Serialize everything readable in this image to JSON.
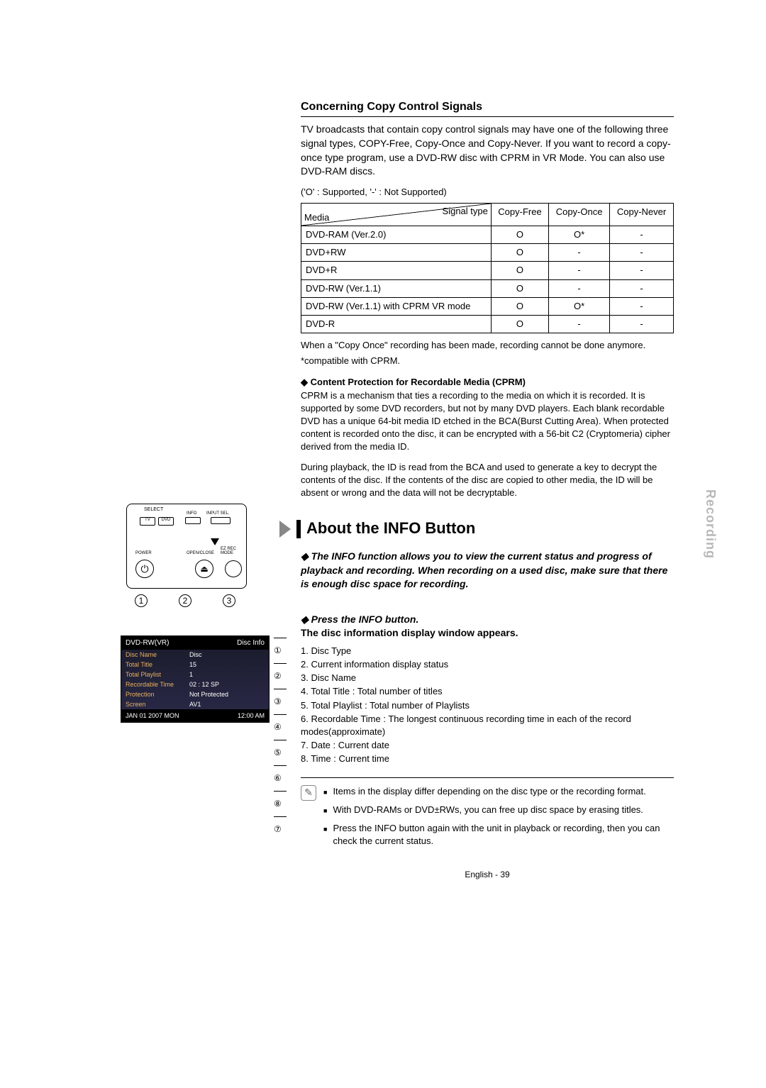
{
  "side_tab": "Recording",
  "section1": {
    "heading": "Concerning Copy Control Signals",
    "body": "TV broadcasts that contain copy control signals may have one of the following three signal types, COPY-Free, Copy-Once and Copy-Never. If you want to record a copy-once type program, use a DVD-RW disc with CPRM in VR Mode. You can also use DVD-RAM discs.",
    "legend": "('O' : Supported, '-' : Not Supported)"
  },
  "table": {
    "diag_top": "Signal type",
    "diag_bottom": "Media",
    "cols": [
      "Copy-Free",
      "Copy-Once",
      "Copy-Never"
    ],
    "rows": [
      {
        "media": "DVD-RAM (Ver.2.0)",
        "v": [
          "O",
          "O*",
          "-"
        ]
      },
      {
        "media": "DVD+RW",
        "v": [
          "O",
          "-",
          "-"
        ]
      },
      {
        "media": "DVD+R",
        "v": [
          "O",
          "-",
          "-"
        ]
      },
      {
        "media": "DVD-RW (Ver.1.1)",
        "v": [
          "O",
          "-",
          "-"
        ]
      },
      {
        "media": "DVD-RW (Ver.1.1) with CPRM VR mode",
        "v": [
          "O",
          "O*",
          "-"
        ]
      },
      {
        "media": "DVD-R",
        "v": [
          "O",
          "-",
          "-"
        ]
      }
    ],
    "footnote1": "When a \"Copy Once\" recording has been made, recording cannot be done anymore.",
    "footnote2": "*compatible with CPRM."
  },
  "cprm": {
    "head": "Content Protection for Recordable Media (CPRM)",
    "p1": "CPRM is a mechanism that ties a recording to the media on which it is recorded. It is supported by some DVD recorders, but not by many DVD players. Each blank recordable DVD has a unique 64-bit media ID etched in the BCA(Burst Cutting Area). When protected content is recorded onto the disc, it can be encrypted with a 56-bit C2 (Cryptomeria) cipher derived from the media ID.",
    "p2": "During playback, the ID is read from the BCA and used to generate a key to decrypt the contents of the disc. If the contents of the disc are copied to other media, the ID will be absent or wrong and the data will not be decryptable."
  },
  "section2": {
    "title": "About the INFO Button",
    "lead": "The INFO function allows you to view the current status and progress of playback and recording. When recording on a used disc, make sure that there is enough disc space for recording.",
    "step_head": "Press the INFO button.",
    "step_sub": "The disc information display window appears.",
    "items": [
      "1. Disc Type",
      "2. Current information display status",
      "3. Disc Name",
      "4. Total Title : Total number of titles",
      "5. Total Playlist : Total number of Playlists",
      "6. Recordable Time : The longest continuous recording time in each of the record modes(approximate)",
      "7. Date : Current date",
      "8. Time : Current time"
    ]
  },
  "notes": [
    "Items in the display differ depending on the disc type or the recording format.",
    "With DVD-RAMs or DVD±RWs, you can free up disc space by erasing titles.",
    "Press the INFO button again with the unit in playback or recording, then you can check the current status."
  ],
  "notes_info_word": "INFO",
  "page_footer": "English - 39",
  "remote": {
    "select": "SELECT",
    "tv": "TV",
    "dvd": "DVD",
    "info": "INFO",
    "input_sel": "INPUT SEL.",
    "power": "POWER",
    "open_close": "OPEN/CLOSE",
    "ez_rec": "EZ REC MODE",
    "nums": [
      "1",
      "2",
      "3"
    ]
  },
  "disc_panel": {
    "hdr_left": "DVD-RW(VR)",
    "hdr_right": "Disc Info",
    "rows": [
      {
        "k": "Disc Name",
        "v": "Disc"
      },
      {
        "k": "Total Title",
        "v": "15"
      },
      {
        "k": "Total Playlist",
        "v": "1"
      },
      {
        "k": "Recordable Time",
        "v": "02 : 12  SP"
      },
      {
        "k": "Protection",
        "v": "Not Protected"
      },
      {
        "k": "Screen",
        "v": "AV1"
      }
    ],
    "ftr_left": "JAN 01 2007 MON",
    "ftr_right": "12:00 AM",
    "callouts": [
      "①",
      "②",
      "③",
      "④",
      "⑤",
      "⑥",
      "⑧",
      "⑦"
    ]
  }
}
